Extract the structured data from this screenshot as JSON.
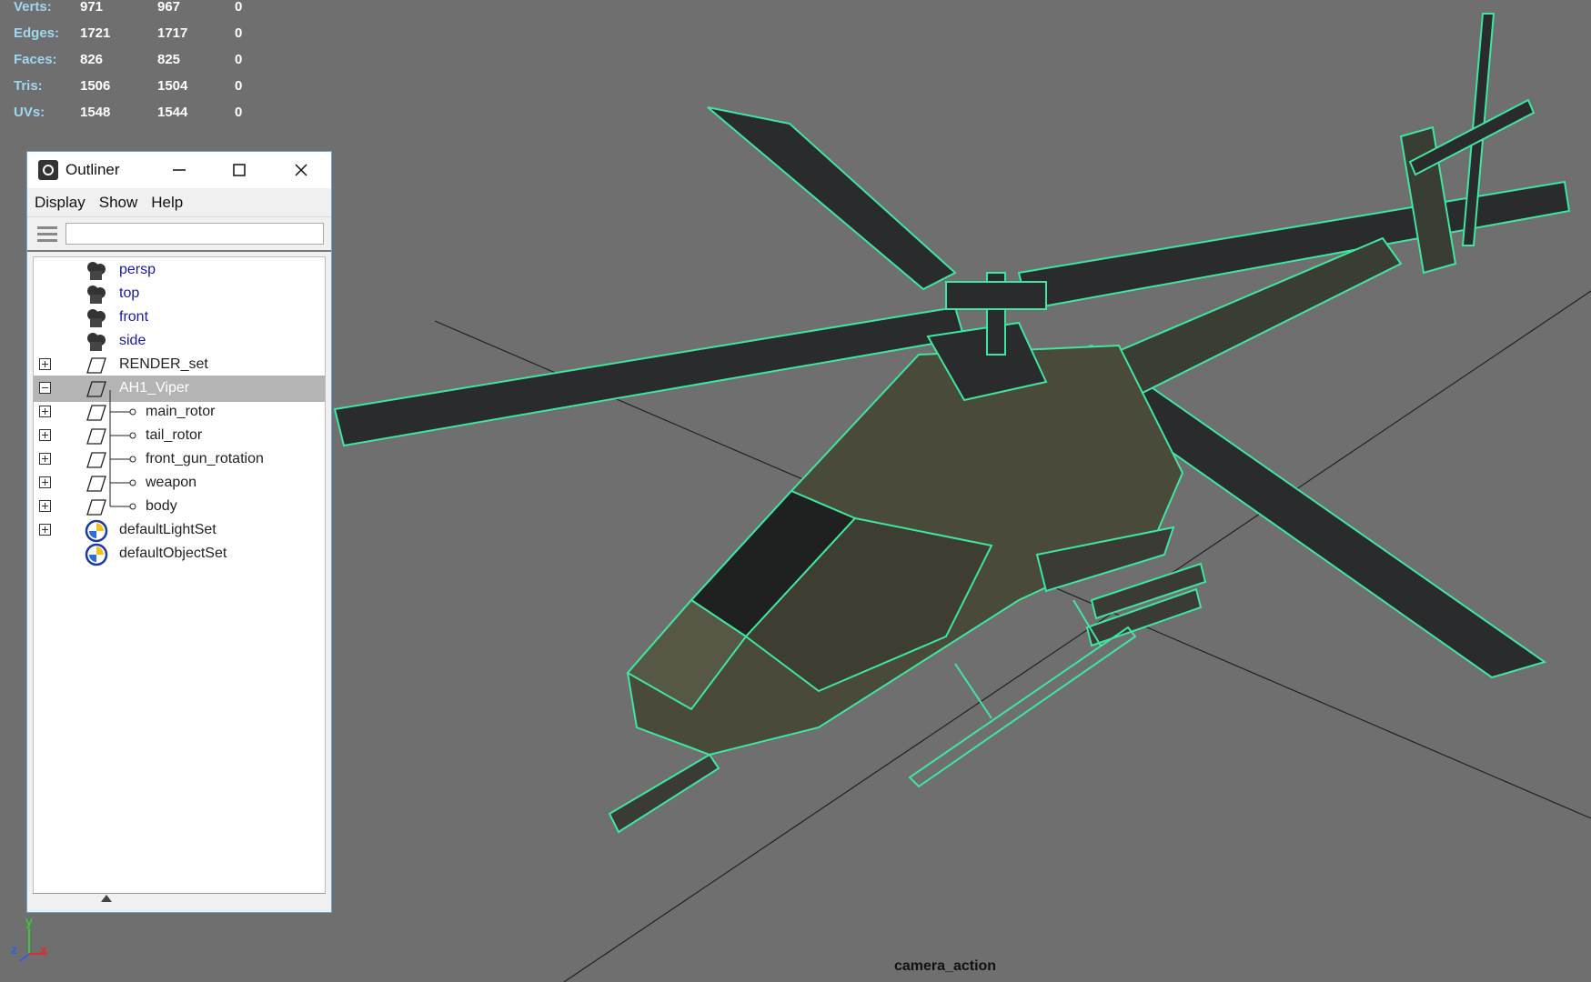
{
  "hud": {
    "rows": [
      {
        "label": "Verts:",
        "v1": "971",
        "v2": "967",
        "v3": "0"
      },
      {
        "label": "Edges:",
        "v1": "1721",
        "v2": "1717",
        "v3": "0"
      },
      {
        "label": "Faces:",
        "v1": "826",
        "v2": "825",
        "v3": "0"
      },
      {
        "label": "Tris:",
        "v1": "1506",
        "v2": "1504",
        "v3": "0"
      },
      {
        "label": "UVs:",
        "v1": "1548",
        "v2": "1544",
        "v3": "0"
      }
    ]
  },
  "outliner": {
    "title": "Outliner",
    "window_buttons": {
      "minimize": "minimize-icon",
      "maximize": "maximize-icon",
      "close": "close-icon"
    },
    "menu": [
      "Display",
      "Show",
      "Help"
    ],
    "filter_value": "",
    "items": [
      {
        "label": "persp",
        "kind": "camera",
        "expander": "none"
      },
      {
        "label": "top",
        "kind": "camera",
        "expander": "none"
      },
      {
        "label": "front",
        "kind": "camera",
        "expander": "none"
      },
      {
        "label": "side",
        "kind": "camera",
        "expander": "none"
      },
      {
        "label": "RENDER_set",
        "kind": "transform",
        "expander": "plus"
      },
      {
        "label": "AH1_Viper",
        "kind": "transform",
        "expander": "minus",
        "selected": true
      },
      {
        "label": "main_rotor",
        "kind": "transform",
        "expander": "plus",
        "child": true
      },
      {
        "label": "tail_rotor",
        "kind": "transform",
        "expander": "plus",
        "child": true
      },
      {
        "label": "front_gun_rotation",
        "kind": "transform",
        "expander": "plus",
        "child": true
      },
      {
        "label": "weapon",
        "kind": "transform",
        "expander": "plus",
        "child": true
      },
      {
        "label": "body",
        "kind": "transform",
        "expander": "plus",
        "child": true
      },
      {
        "label": "defaultLightSet",
        "kind": "set",
        "expander": "plus"
      },
      {
        "label": "defaultObjectSet",
        "kind": "set",
        "expander": "none"
      }
    ]
  },
  "viewport": {
    "camera_label": "camera_action",
    "axes": {
      "y": "y",
      "z": "z",
      "x": "x"
    },
    "colors": {
      "background": "#6f6f6f",
      "wireframe": "#33e6a0",
      "selection_highlight": "#b4b4b4"
    }
  }
}
